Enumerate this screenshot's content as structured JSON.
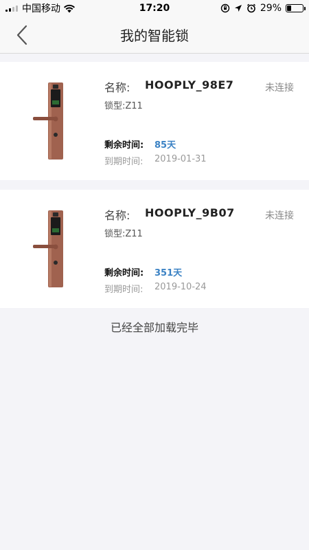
{
  "status_bar": {
    "carrier": "中国移动",
    "time": "17:20",
    "battery_text": "29%",
    "battery_level": 0.29
  },
  "nav": {
    "title": "我的智能锁"
  },
  "locks": [
    {
      "name_label": "名称:",
      "name": "HOOPLY_98E7",
      "status": "未连接",
      "model": "锁型:Z11",
      "remaining_label": "剩余时间:",
      "remaining": "85天",
      "expiry_label": "到期时间:",
      "expiry": "2019-01-31"
    },
    {
      "name_label": "名称:",
      "name": "HOOPLY_9B07",
      "status": "未连接",
      "model": "锁型:Z11",
      "remaining_label": "剩余时间:",
      "remaining": "351天",
      "expiry_label": "到期时间:",
      "expiry": "2019-10-24"
    }
  ],
  "footer": {
    "loaded_text": "已经全部加载完毕"
  },
  "colors": {
    "accent": "#3b82c4",
    "lock_body": "#a0624f"
  }
}
